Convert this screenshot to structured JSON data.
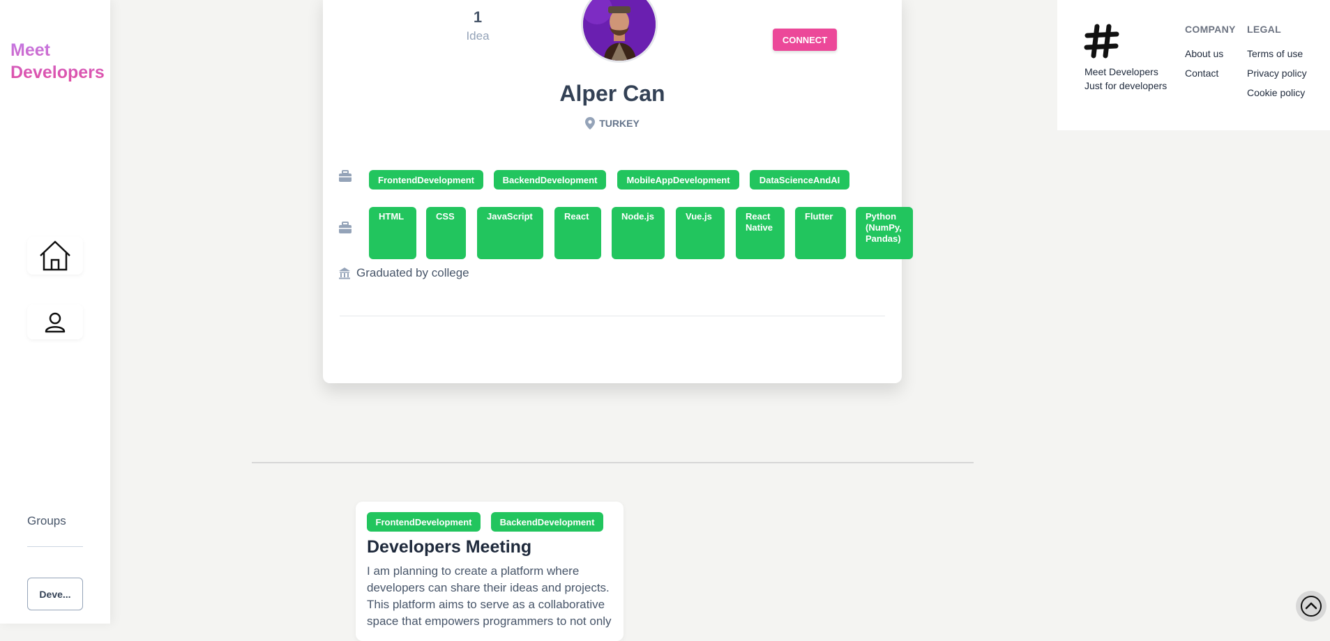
{
  "sidebar": {
    "brand_line1": "Meet",
    "brand_line2": "Developers",
    "groups_label": "Groups",
    "group_chip": "Deve..."
  },
  "profile": {
    "idea_count": "1",
    "idea_label": "Idea",
    "connect_label": "CONNECT",
    "name": "Alper Can",
    "location": "TURKEY",
    "interests": [
      "FrontendDevelopment",
      "BackendDevelopment",
      "MobileAppDevelopment",
      "DataScienceAndAI"
    ],
    "skills": [
      "HTML",
      "CSS",
      "JavaScript",
      "React",
      "Node.js",
      "Vue.js",
      "React Native",
      "Flutter",
      "Python (NumPy, Pandas)"
    ],
    "education": "Graduated by college"
  },
  "idea": {
    "tags": [
      "FrontendDevelopment",
      "BackendDevelopment"
    ],
    "title": "Developers Meeting",
    "description": "I am planning to create a platform where developers can share their ideas and projects. This platform aims to serve as a collaborative space that empowers programmers to not only"
  },
  "footer": {
    "brand_line1": "Meet Developers",
    "brand_line2": "Just for developers",
    "company_heading": "COMPANY",
    "company_links": [
      "About us",
      "Contact"
    ],
    "legal_heading": "LEGAL",
    "legal_links": [
      "Terms of use",
      "Privacy policy",
      "Cookie policy"
    ]
  },
  "icons": {
    "home": "home-icon",
    "profile": "user-icon",
    "briefcase": "briefcase-icon",
    "location": "map-pin-icon",
    "education": "institution-icon",
    "logo": "hash-logo",
    "scroll_top": "chevron-up-icon"
  },
  "colors": {
    "accent_pink": "#ec4899",
    "tag_green": "#22c55e",
    "brand_gradient_start": "#c17ce8",
    "brand_gradient_end": "#e24aa0"
  }
}
